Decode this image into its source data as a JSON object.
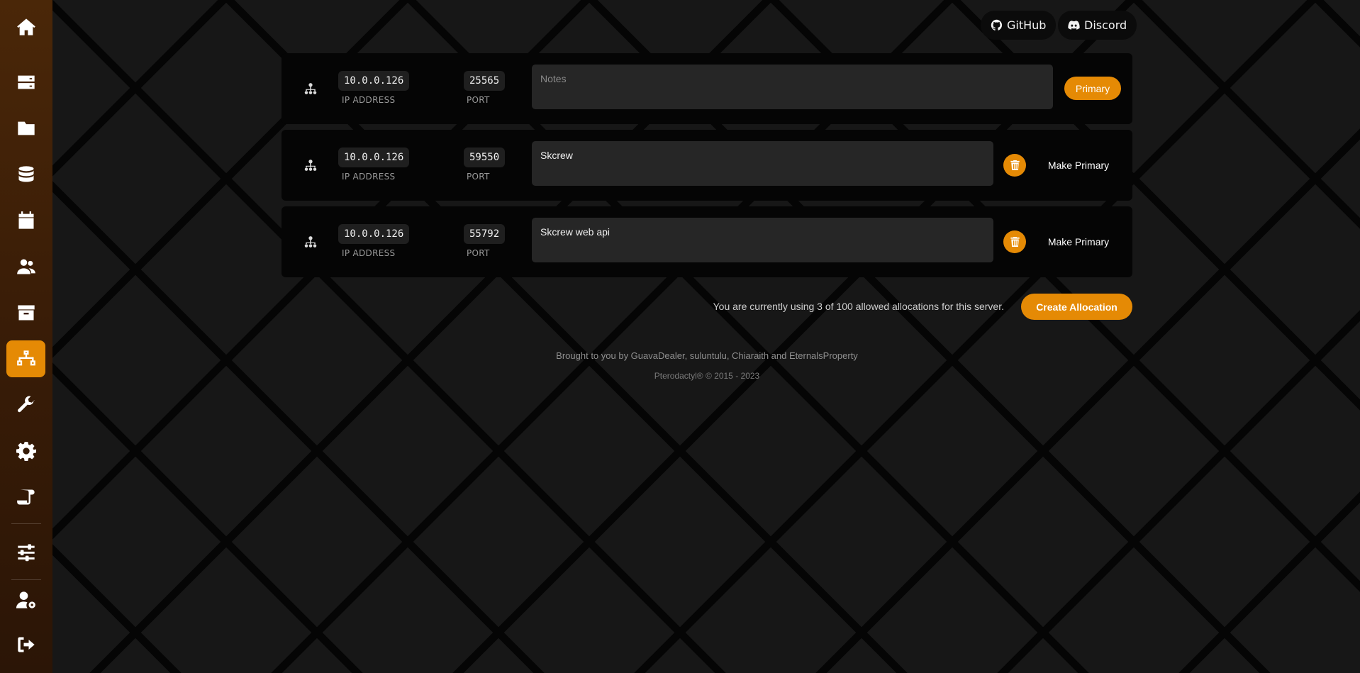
{
  "sidebar": {
    "items": [
      {
        "icon": "home-icon",
        "active": false
      },
      {
        "icon": "server-icon",
        "active": false
      },
      {
        "icon": "folder-icon",
        "active": false
      },
      {
        "icon": "database-icon",
        "active": false
      },
      {
        "icon": "calendar-icon",
        "active": false
      },
      {
        "icon": "users-icon",
        "active": false
      },
      {
        "icon": "archive-icon",
        "active": false
      },
      {
        "icon": "network-icon",
        "active": true
      },
      {
        "icon": "wrench-icon",
        "active": false
      },
      {
        "icon": "gear-icon",
        "active": false
      },
      {
        "icon": "scroll-icon",
        "active": false
      },
      {
        "icon": "sliders-icon",
        "active": false
      },
      {
        "icon": "user-gear-icon",
        "active": false
      },
      {
        "icon": "sign-out-icon",
        "active": false
      }
    ]
  },
  "header": {
    "github_label": "GitHub",
    "discord_label": "Discord"
  },
  "allocations": [
    {
      "ip": "10.0.0.126",
      "ip_label": "IP ADDRESS",
      "port": "25565",
      "port_label": "PORT",
      "notes": "",
      "notes_placeholder": "Notes",
      "is_primary": true,
      "primary_label": "Primary"
    },
    {
      "ip": "10.0.0.126",
      "ip_label": "IP ADDRESS",
      "port": "59550",
      "port_label": "PORT",
      "notes": "Skcrew",
      "is_primary": false,
      "make_primary_label": "Make Primary"
    },
    {
      "ip": "10.0.0.126",
      "ip_label": "IP ADDRESS",
      "port": "55792",
      "port_label": "PORT",
      "notes": "Skcrew web api",
      "is_primary": false,
      "make_primary_label": "Make Primary"
    }
  ],
  "usage_text": "You are currently using 3 of 100 allowed allocations for this server.",
  "create_button_label": "Create Allocation",
  "footer": {
    "credits": "Brought to you by GuavaDealer, suluntulu, Chiaraith and EternalsProperty",
    "copyright": "Pterodactyl® © 2015 - 2023"
  },
  "colors": {
    "accent": "#e58a05",
    "card_bg": "#050505",
    "sidebar_top": "#4a2708"
  }
}
